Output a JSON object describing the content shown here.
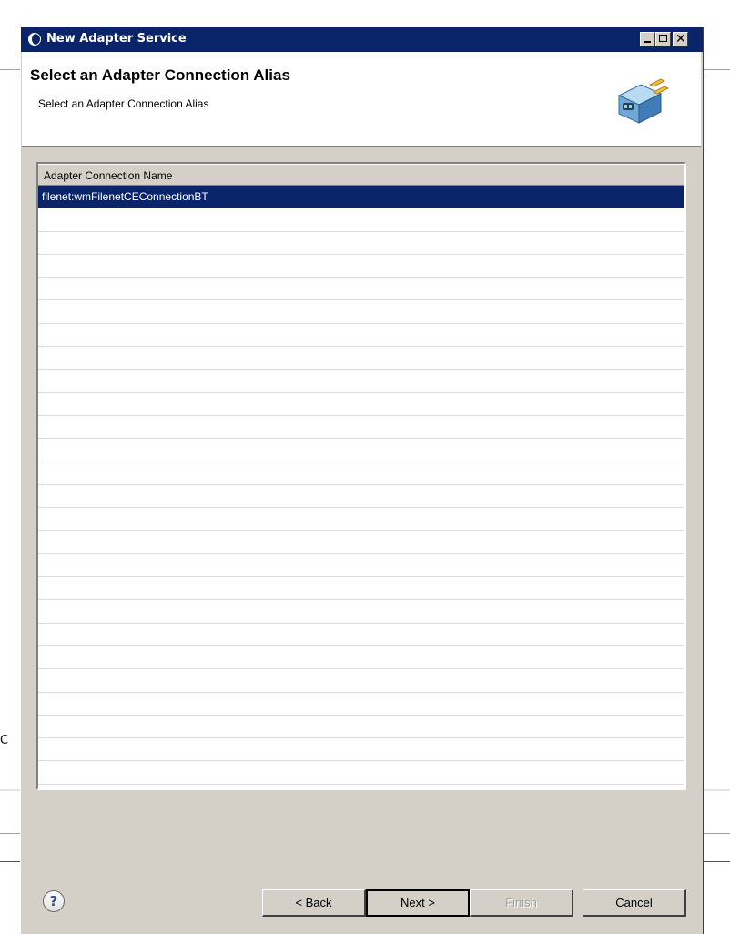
{
  "dialog": {
    "title": "New Adapter Service",
    "header_title": "Select an Adapter Connection Alias",
    "header_subtitle": "Select an Adapter Connection Alias"
  },
  "table": {
    "column_header": "Adapter Connection Name",
    "rows": [
      "filenet:wmFilenetCEConnectionBT"
    ],
    "selected_index": 0
  },
  "buttons": {
    "help": "?",
    "back": "< Back",
    "next": "Next >",
    "finish": "Finish",
    "cancel": "Cancel"
  },
  "background": {
    "stray_char": "C"
  },
  "icons": {
    "window": "circle-window-icon",
    "header": "adapter-plug-icon"
  }
}
